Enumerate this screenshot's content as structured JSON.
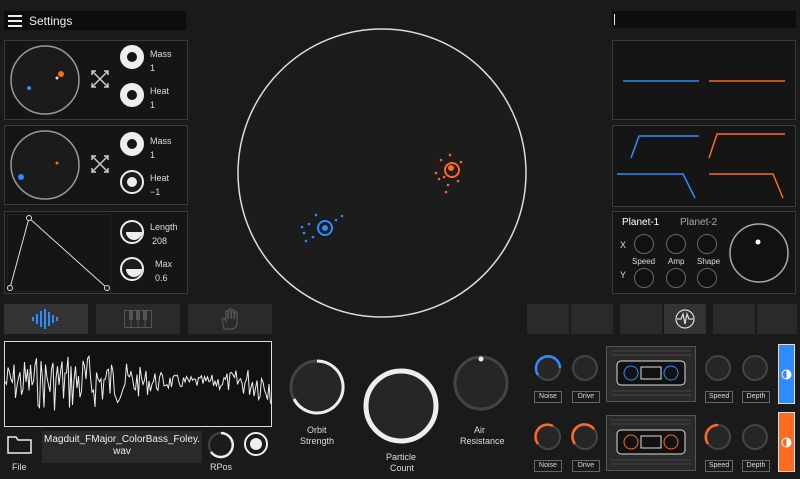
{
  "header": {
    "title": "Settings"
  },
  "planet_a": {
    "mass_label": "Mass",
    "mass_value": "1",
    "heat_label": "Heat",
    "heat_value": "1"
  },
  "planet_b": {
    "mass_label": "Mass",
    "mass_value": "1",
    "heat_label": "Heat",
    "heat_value": "−1"
  },
  "envelope": {
    "length_label": "Length",
    "length_value": "208",
    "max_label": "Max",
    "max_value": "0.6"
  },
  "lfo": {
    "tab1": "Planet-1",
    "tab2": "Planet-2",
    "row_x": "X",
    "row_y": "Y",
    "speed": "Speed",
    "amp": "Amp",
    "shape": "Shape"
  },
  "file": {
    "label": "File",
    "name_line1": "Magduit_FMajor_ColorBass_Foley.",
    "name_line2": "wav",
    "rpos": "RPos"
  },
  "main_knobs": {
    "orbit_line1": "Orbit",
    "orbit_line2": "Strength",
    "particle_line1": "Particle",
    "particle_line2": "Count",
    "air_line1": "Air",
    "air_line2": "Resistance"
  },
  "fx_blue": {
    "noise": "Noise",
    "drive": "Drive",
    "speed": "Speed",
    "depth": "Depth"
  },
  "fx_orange": {
    "noise": "Noise",
    "drive": "Drive",
    "speed": "Speed",
    "depth": "Depth"
  },
  "colors": {
    "blue": "#2d8cff",
    "orange": "#ff6a1f",
    "bg": "#1a1a1a",
    "panel": "#151515"
  }
}
